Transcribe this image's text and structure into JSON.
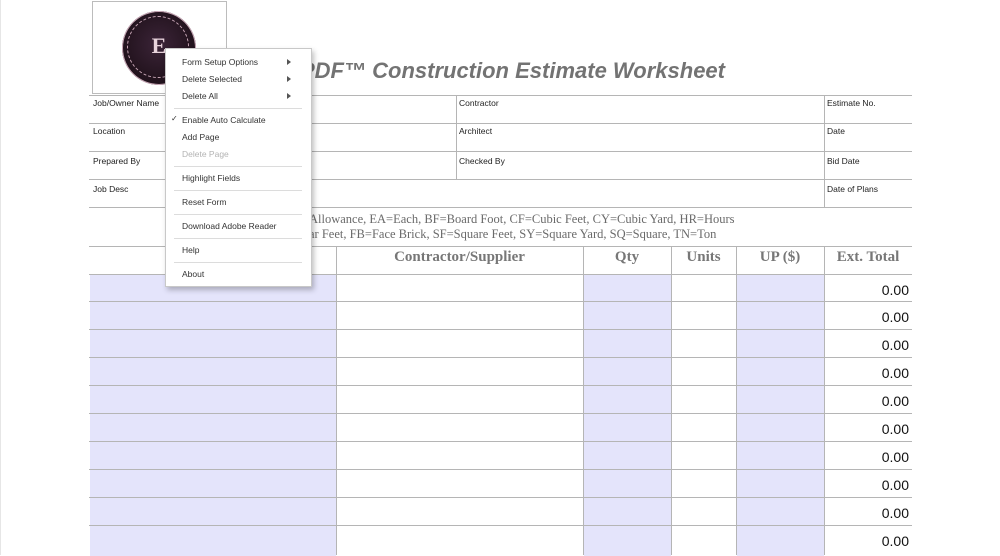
{
  "form": {
    "title": "PDF™ Construction Estimate Worksheet",
    "header_fields": [
      {
        "label": "Job/Owner Name"
      },
      {
        "label": "Contractor"
      },
      {
        "label": "Estimate No."
      },
      {
        "label": "Location"
      },
      {
        "label": "Architect"
      },
      {
        "label": "Date"
      },
      {
        "label": "Prepared By"
      },
      {
        "label": "Checked By"
      },
      {
        "label": "Bid Date"
      },
      {
        "label": "Job Desc"
      },
      {
        "label": "Date of Plans"
      }
    ],
    "legend_line1": "Allowance,  EA=Each, BF=Board Foot, CF=Cubic Feet, CY=Cubic Yard, HR=Hours",
    "legend_line2": "ar Feet, FB=Face Brick, SF=Square Feet, SY=Square Yard, SQ=Square, TN=Ton",
    "columns": [
      "Contractor/Supplier",
      "Qty",
      "Units",
      "UP ($)",
      "Ext. Total"
    ],
    "rows": [
      {
        "total": "0.00"
      },
      {
        "total": "0.00"
      },
      {
        "total": "0.00"
      },
      {
        "total": "0.00"
      },
      {
        "total": "0.00"
      },
      {
        "total": "0.00"
      },
      {
        "total": "0.00"
      },
      {
        "total": "0.00"
      },
      {
        "total": "0.00"
      },
      {
        "total": "0.00"
      }
    ],
    "shade_color": "#e4e4fb"
  },
  "context_menu": {
    "items": [
      {
        "label": "Form Setup Options",
        "submenu": true
      },
      {
        "label": "Delete Selected",
        "submenu": true
      },
      {
        "label": "Delete All",
        "submenu": true
      },
      {
        "label": "Enable Auto Calculate",
        "checked": true
      },
      {
        "label": "Add Page"
      },
      {
        "label": "Delete Page",
        "disabled": true
      },
      {
        "label": "Highlight Fields"
      },
      {
        "label": "Reset Form"
      },
      {
        "label": "Download Adobe Reader"
      },
      {
        "label": "Help"
      },
      {
        "label": "About"
      }
    ],
    "check_glyph": "✓"
  },
  "logo": {
    "glyph": "E"
  }
}
